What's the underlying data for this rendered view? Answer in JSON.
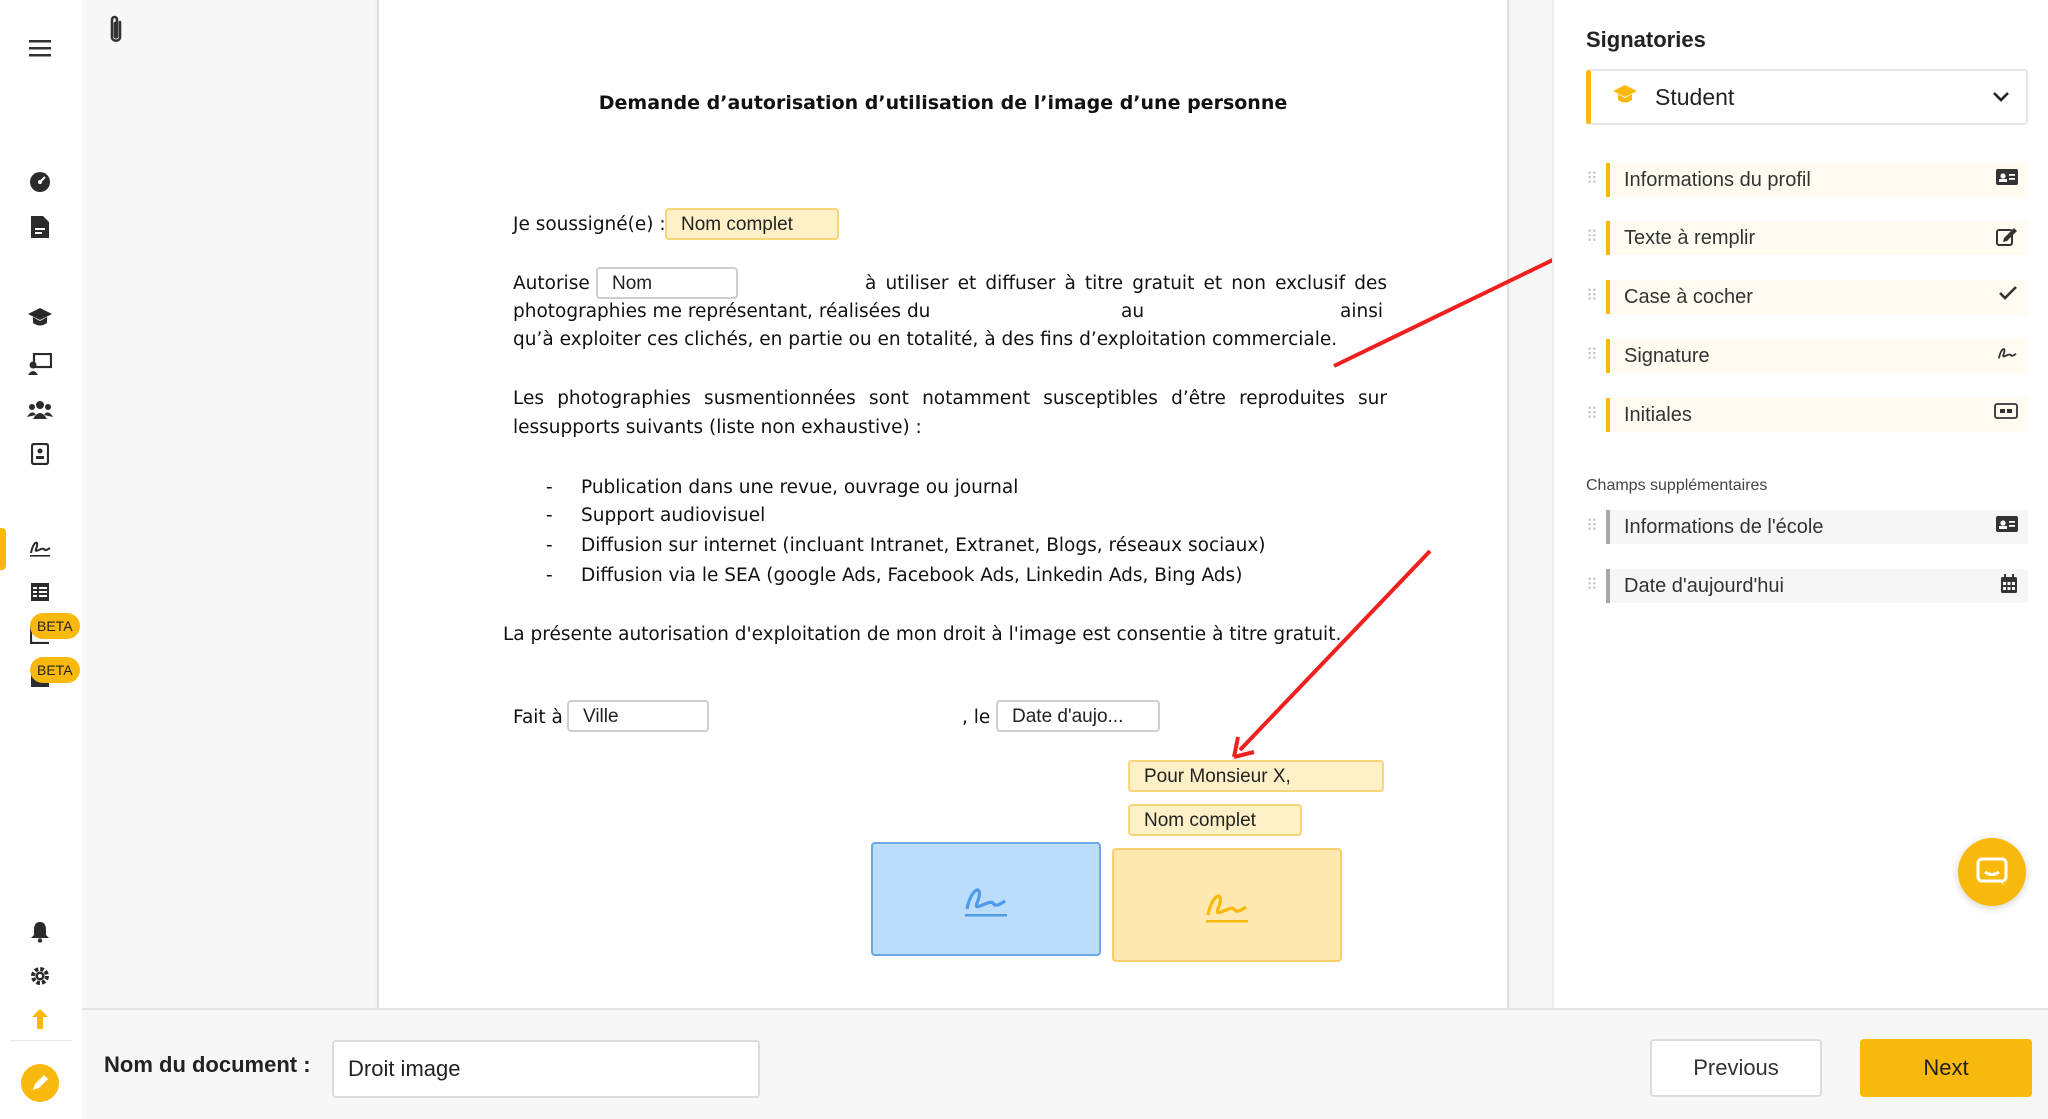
{
  "nav": {
    "menu_icon": "hamburger-icon",
    "beta_label": "BETA",
    "beta_label_2": "BETA",
    "accent": "#f9b90c"
  },
  "document": {
    "title": "Demande d’autorisation d’utilisation de l’image d’une personne",
    "line_soussigne": "Je soussigné(e) :",
    "field_nom_complet": "Nom complet",
    "line_autorise": "Autorise",
    "field_nom": "Nom",
    "line_autorise_rest": "à utiliser et diffuser à titre gratuit et non exclusif des",
    "line_photos": "photographies me représentant, réalisées du",
    "line_photos_au": "au",
    "line_photos_ainsi": "ainsi",
    "line_exploiter": "qu’à exploiter ces clichés, en partie ou en totalité, à des fins d’exploitation commerciale.",
    "para_supports_1": "Les photographies susmentionnées sont notamment susceptibles d’être reproduites sur",
    "para_supports_2": "lessupports suivants (liste non exhaustive) :",
    "bullets": [
      "Publication dans une revue, ouvrage ou journal",
      "Support audiovisuel",
      "Diffusion sur internet (incluant Intranet, Extranet, Blogs, réseaux sociaux)",
      "Diffusion via le SEA (google Ads, Facebook Ads, Linkedin Ads, Bing Ads)"
    ],
    "bullet_dash": "-",
    "para_gratuit": "La présente autorisation d'exploitation de mon droit à l'image est consentie à titre gratuit.",
    "fait_a": "Fait à",
    "field_ville": "Ville",
    "le": ", le",
    "field_date": "Date d'aujo...",
    "field_pour_monsieur": "Pour Monsieur X,",
    "field_nom_complet_2": "Nom complet"
  },
  "signatories": {
    "title": "Signatories",
    "selected": "Student",
    "items": [
      {
        "label": "Informations du profil",
        "icon": "id-card-icon"
      },
      {
        "label": "Texte à remplir",
        "icon": "edit-icon"
      },
      {
        "label": "Case à cocher",
        "icon": "check-icon"
      },
      {
        "label": "Signature",
        "icon": "signature-icon"
      },
      {
        "label": "Initiales",
        "icon": "initials-icon"
      }
    ],
    "extra_title": "Champs supplémentaires",
    "extra_items": [
      {
        "label": "Informations de l'école",
        "icon": "id-card-icon"
      },
      {
        "label": "Date d'aujourd'hui",
        "icon": "calendar-icon"
      }
    ]
  },
  "bottom": {
    "doc_name_label": "Nom du document :",
    "doc_name_value": "Droit image",
    "previous": "Previous",
    "next": "Next"
  }
}
